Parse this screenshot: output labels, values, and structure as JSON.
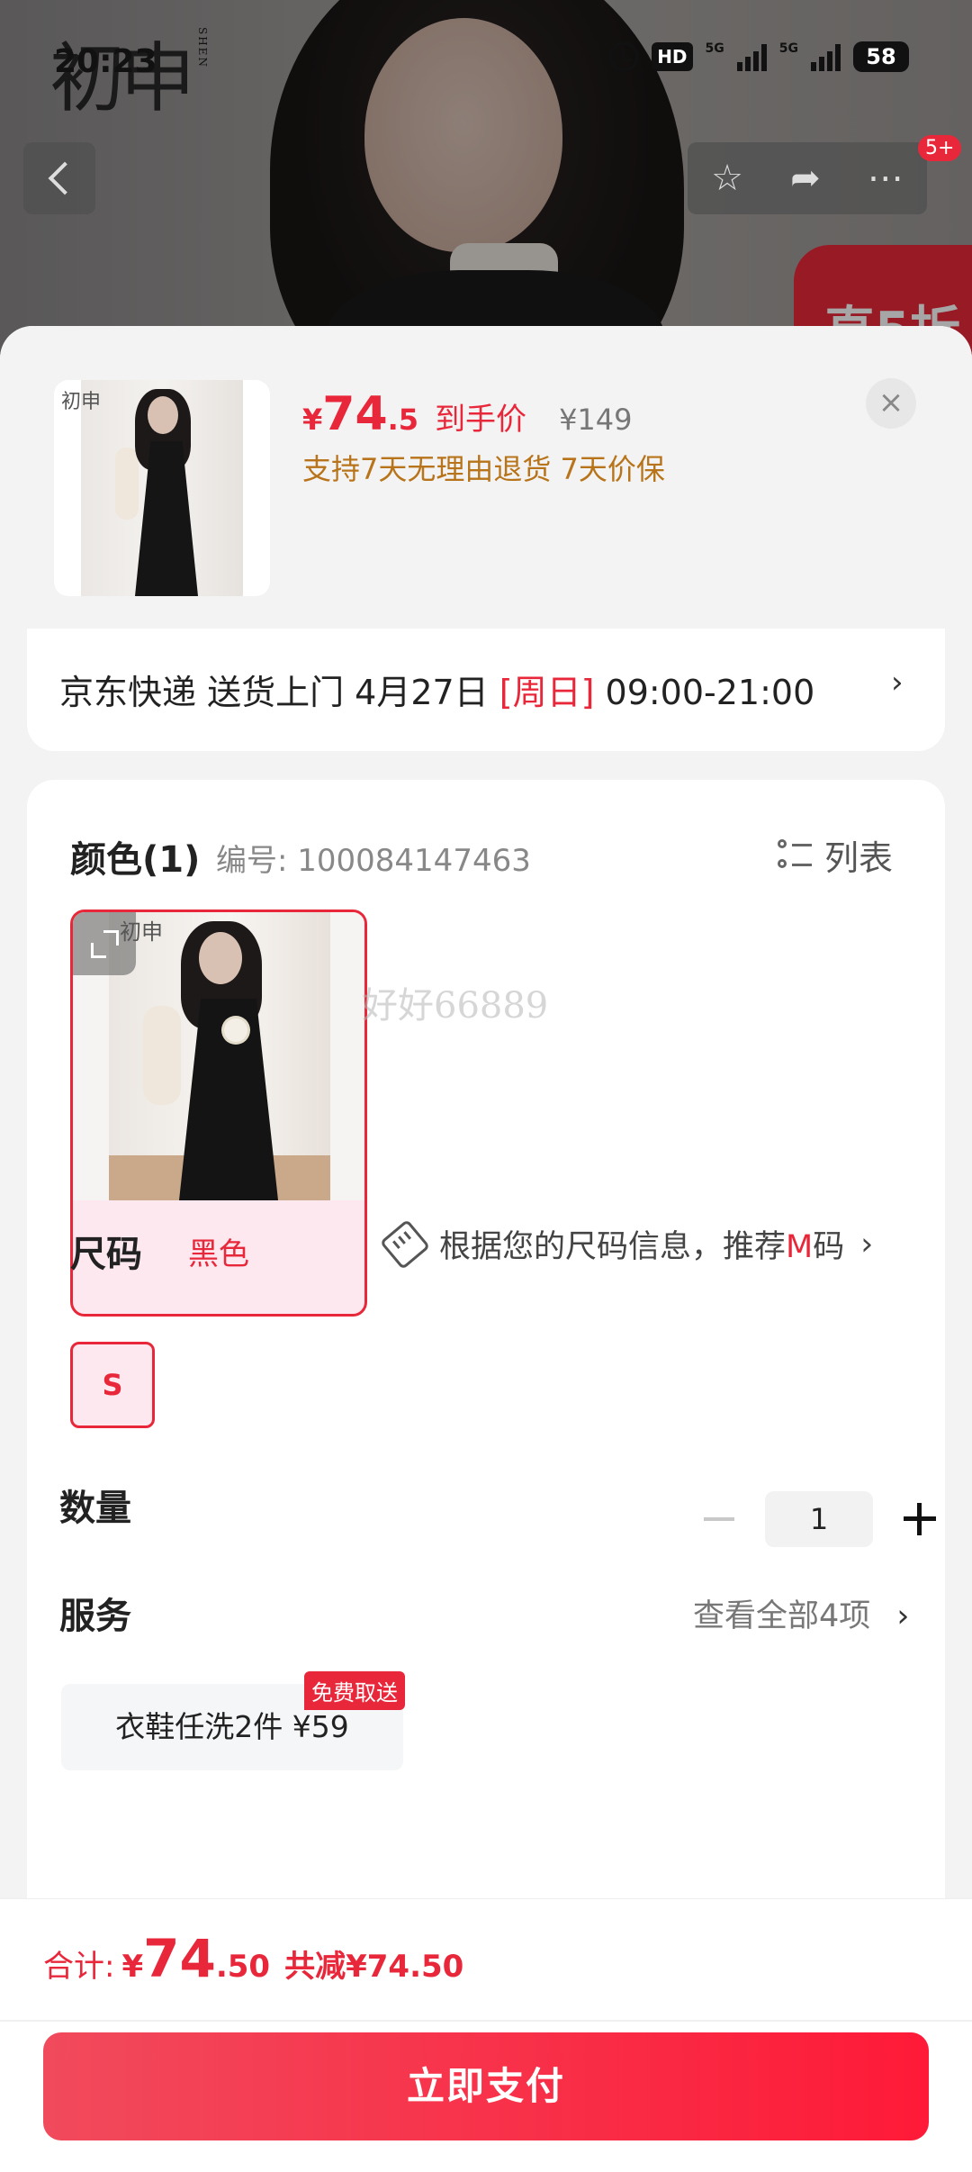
{
  "status_bar": {
    "time": "20:23",
    "hd": "HD",
    "hd_sub": "1 2",
    "net1": "5G",
    "net2": "5G",
    "battery": "58"
  },
  "hero": {
    "brand": "初申",
    "brand_sub": "SHEN",
    "discount_text": "直5折",
    "badge": "5+"
  },
  "product": {
    "thumb_logo": "初申",
    "price_symbol": "¥",
    "price_int": "74",
    "price_dec": ".5",
    "price_label": "到手价",
    "original_price": "¥149",
    "promise": "支持7天无理由退货 7天价保",
    "close": "×"
  },
  "delivery": {
    "prefix": "京东快递 送货上门 4月27日 ",
    "day": "[周日]",
    "time": " 09:00-21:00",
    "chevron": "›"
  },
  "color_section": {
    "title": "颜色(1)",
    "code": "编号: 100084147463",
    "list_label": "列表",
    "option_logo": "初申",
    "option_label": "黑色",
    "watermark": "好好66889"
  },
  "size_section": {
    "title": "尺码",
    "tip_before": "根据您的尺码信息，推荐",
    "tip_highlight": "M",
    "tip_after": "码",
    "chevron": "›",
    "option": "S"
  },
  "quantity_section": {
    "title": "数量",
    "value": "1"
  },
  "service_section": {
    "title": "服务",
    "view_all": "查看全部4项",
    "chevron": "›",
    "item": "衣鞋任洗2件  ¥59",
    "badge": "免费取送"
  },
  "footer": {
    "total_label": "合计:",
    "total_symbol": "¥",
    "total_int": "74",
    "total_dec": ".50",
    "savings": "共减¥74.50",
    "pay_label": "立即支付"
  },
  "colors": {
    "accent": "#e8283a",
    "promise": "#b8741a",
    "selected_bg": "#fce8ee"
  }
}
